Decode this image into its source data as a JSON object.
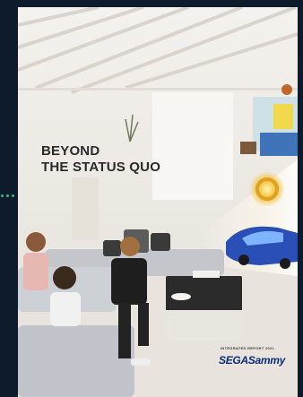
{
  "cover": {
    "title_line1": "BEYOND",
    "title_line2": "THE STATUS QUO",
    "report_label": "INTEGRATED REPORT 2021",
    "brand": "SEGASammy"
  },
  "colors": {
    "page_background": "#0e1b2c",
    "indicator_dots": "#2bbf7a",
    "logo_blue": "#0a2a7a",
    "accent_gold": "#e0a021"
  }
}
